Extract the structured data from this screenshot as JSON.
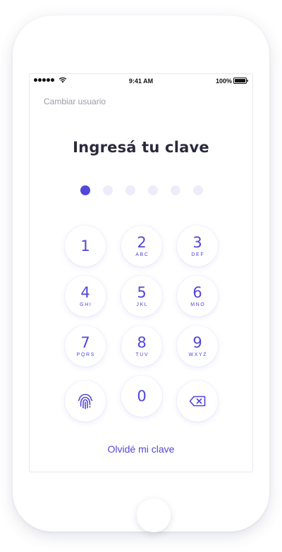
{
  "status_bar": {
    "time": "9:41 AM",
    "battery": "100%"
  },
  "header": {
    "switch_user": "Cambiar usuario",
    "title": "Ingresá tu clave"
  },
  "pin": {
    "length": 6,
    "entered": 1
  },
  "keypad": {
    "keys": [
      {
        "digit": "1",
        "letters": ""
      },
      {
        "digit": "2",
        "letters": "ABC"
      },
      {
        "digit": "3",
        "letters": "DEF"
      },
      {
        "digit": "4",
        "letters": "GHI"
      },
      {
        "digit": "5",
        "letters": "JKL"
      },
      {
        "digit": "6",
        "letters": "MNO"
      },
      {
        "digit": "7",
        "letters": "PQRS"
      },
      {
        "digit": "8",
        "letters": "TUV"
      },
      {
        "digit": "9",
        "letters": "WXYZ"
      },
      {
        "digit": "0",
        "letters": ""
      }
    ],
    "fingerprint_icon": "fingerprint-icon",
    "delete_icon": "backspace-icon"
  },
  "footer": {
    "forgot_password": "Olvidé mi clave"
  },
  "colors": {
    "accent": "#5346d8",
    "dot_empty": "#eeecfa",
    "title": "#2b2a3d",
    "muted": "#9a9aa8"
  }
}
